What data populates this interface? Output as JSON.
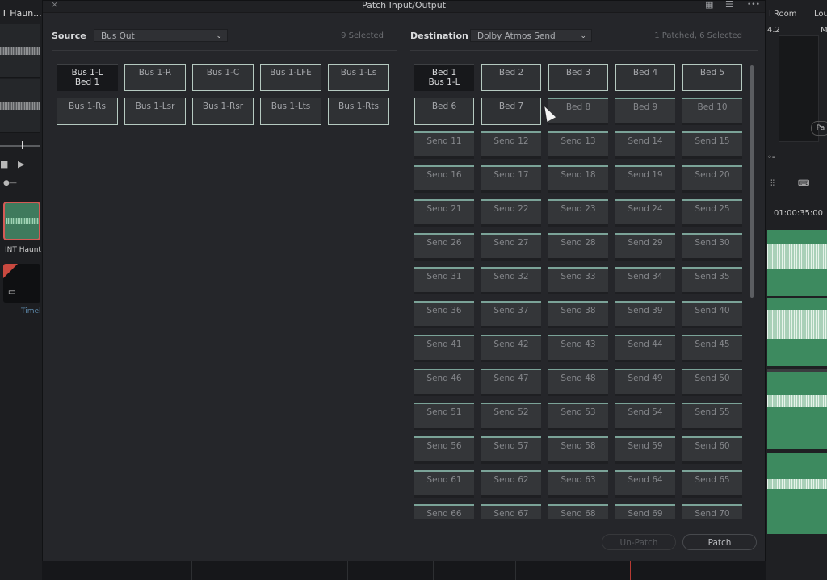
{
  "dialog": {
    "title": "Patch Input/Output",
    "close_label": "×",
    "grid_view_label": "▦",
    "list_view_label": "☰",
    "more_label": "•••"
  },
  "source": {
    "label": "Source",
    "dropdown_value": "Bus Out",
    "count_text": "9 Selected",
    "buttons": [
      {
        "line1": "Bus 1-L",
        "line2": "Bed 1",
        "state": "patched"
      },
      {
        "line1": "Bus 1-R",
        "line2": "",
        "state": "selected"
      },
      {
        "line1": "Bus 1-C",
        "line2": "",
        "state": "selected"
      },
      {
        "line1": "Bus 1-LFE",
        "line2": "",
        "state": "selected"
      },
      {
        "line1": "Bus 1-Ls",
        "line2": "",
        "state": "selected"
      },
      {
        "line1": "Bus 1-Rs",
        "line2": "",
        "state": "selected"
      },
      {
        "line1": "Bus 1-Lsr",
        "line2": "",
        "state": "selected"
      },
      {
        "line1": "Bus 1-Rsr",
        "line2": "",
        "state": "selected"
      },
      {
        "line1": "Bus 1-Lts",
        "line2": "",
        "state": "selected"
      },
      {
        "line1": "Bus 1-Rts",
        "line2": "",
        "state": "selected"
      }
    ]
  },
  "destination": {
    "label": "Destination",
    "dropdown_value": "Dolby Atmos Send",
    "count_text": "1 Patched, 6 Selected",
    "buttons": [
      {
        "line1": "Bed 1",
        "line2": "Bus 1-L",
        "state": "patched"
      },
      {
        "line1": "Bed 2",
        "line2": "",
        "state": "selected"
      },
      {
        "line1": "Bed 3",
        "line2": "",
        "state": "selected"
      },
      {
        "line1": "Bed 4",
        "line2": "",
        "state": "selected"
      },
      {
        "line1": "Bed 5",
        "line2": "",
        "state": "selected"
      },
      {
        "line1": "Bed 6",
        "line2": "",
        "state": "selected"
      },
      {
        "line1": "Bed 7",
        "line2": "",
        "state": "selected"
      },
      {
        "line1": "Bed 8",
        "line2": "",
        "state": "normal"
      },
      {
        "line1": "Bed 9",
        "line2": "",
        "state": "normal"
      },
      {
        "line1": "Bed 10",
        "line2": "",
        "state": "normal"
      },
      {
        "line1": "Send 11",
        "line2": "",
        "state": "normal"
      },
      {
        "line1": "Send 12",
        "line2": "",
        "state": "normal"
      },
      {
        "line1": "Send 13",
        "line2": "",
        "state": "normal"
      },
      {
        "line1": "Send 14",
        "line2": "",
        "state": "normal"
      },
      {
        "line1": "Send 15",
        "line2": "",
        "state": "normal"
      },
      {
        "line1": "Send 16",
        "line2": "",
        "state": "normal"
      },
      {
        "line1": "Send 17",
        "line2": "",
        "state": "normal"
      },
      {
        "line1": "Send 18",
        "line2": "",
        "state": "normal"
      },
      {
        "line1": "Send 19",
        "line2": "",
        "state": "normal"
      },
      {
        "line1": "Send 20",
        "line2": "",
        "state": "normal"
      },
      {
        "line1": "Send 21",
        "line2": "",
        "state": "normal"
      },
      {
        "line1": "Send 22",
        "line2": "",
        "state": "normal"
      },
      {
        "line1": "Send 23",
        "line2": "",
        "state": "normal"
      },
      {
        "line1": "Send 24",
        "line2": "",
        "state": "normal"
      },
      {
        "line1": "Send 25",
        "line2": "",
        "state": "normal"
      },
      {
        "line1": "Send 26",
        "line2": "",
        "state": "normal"
      },
      {
        "line1": "Send 27",
        "line2": "",
        "state": "normal"
      },
      {
        "line1": "Send 28",
        "line2": "",
        "state": "normal"
      },
      {
        "line1": "Send 29",
        "line2": "",
        "state": "normal"
      },
      {
        "line1": "Send 30",
        "line2": "",
        "state": "normal"
      },
      {
        "line1": "Send 31",
        "line2": "",
        "state": "normal"
      },
      {
        "line1": "Send 32",
        "line2": "",
        "state": "normal"
      },
      {
        "line1": "Send 33",
        "line2": "",
        "state": "normal"
      },
      {
        "line1": "Send 34",
        "line2": "",
        "state": "normal"
      },
      {
        "line1": "Send 35",
        "line2": "",
        "state": "normal"
      },
      {
        "line1": "Send 36",
        "line2": "",
        "state": "normal"
      },
      {
        "line1": "Send 37",
        "line2": "",
        "state": "normal"
      },
      {
        "line1": "Send 38",
        "line2": "",
        "state": "normal"
      },
      {
        "line1": "Send 39",
        "line2": "",
        "state": "normal"
      },
      {
        "line1": "Send 40",
        "line2": "",
        "state": "normal"
      },
      {
        "line1": "Send 41",
        "line2": "",
        "state": "normal"
      },
      {
        "line1": "Send 42",
        "line2": "",
        "state": "normal"
      },
      {
        "line1": "Send 43",
        "line2": "",
        "state": "normal"
      },
      {
        "line1": "Send 44",
        "line2": "",
        "state": "normal"
      },
      {
        "line1": "Send 45",
        "line2": "",
        "state": "normal"
      },
      {
        "line1": "Send 46",
        "line2": "",
        "state": "normal"
      },
      {
        "line1": "Send 47",
        "line2": "",
        "state": "normal"
      },
      {
        "line1": "Send 48",
        "line2": "",
        "state": "normal"
      },
      {
        "line1": "Send 49",
        "line2": "",
        "state": "normal"
      },
      {
        "line1": "Send 50",
        "line2": "",
        "state": "normal"
      },
      {
        "line1": "Send 51",
        "line2": "",
        "state": "normal"
      },
      {
        "line1": "Send 52",
        "line2": "",
        "state": "normal"
      },
      {
        "line1": "Send 53",
        "line2": "",
        "state": "normal"
      },
      {
        "line1": "Send 54",
        "line2": "",
        "state": "normal"
      },
      {
        "line1": "Send 55",
        "line2": "",
        "state": "normal"
      },
      {
        "line1": "Send 56",
        "line2": "",
        "state": "normal"
      },
      {
        "line1": "Send 57",
        "line2": "",
        "state": "normal"
      },
      {
        "line1": "Send 58",
        "line2": "",
        "state": "normal"
      },
      {
        "line1": "Send 59",
        "line2": "",
        "state": "normal"
      },
      {
        "line1": "Send 60",
        "line2": "",
        "state": "normal"
      },
      {
        "line1": "Send 61",
        "line2": "",
        "state": "normal"
      },
      {
        "line1": "Send 62",
        "line2": "",
        "state": "normal"
      },
      {
        "line1": "Send 63",
        "line2": "",
        "state": "normal"
      },
      {
        "line1": "Send 64",
        "line2": "",
        "state": "normal"
      },
      {
        "line1": "Send 65",
        "line2": "",
        "state": "normal"
      },
      {
        "line1": "Send 66",
        "line2": "",
        "state": "normal"
      },
      {
        "line1": "Send 67",
        "line2": "",
        "state": "normal"
      },
      {
        "line1": "Send 68",
        "line2": "",
        "state": "normal"
      },
      {
        "line1": "Send 69",
        "line2": "",
        "state": "normal"
      },
      {
        "line1": "Send 70",
        "line2": "",
        "state": "normal"
      }
    ]
  },
  "footer": {
    "unpatch_label": "Un-Patch",
    "patch_label": "Patch"
  },
  "background": {
    "clip_title": "T Haun...n",
    "clip_thumb_label": "INT Haunt",
    "timeline_label": "Timel",
    "room_label": "l Room",
    "loud_label": "Lou",
    "meter_value": "4.2",
    "meter_label": "M",
    "pa_button": "Pa",
    "timecode": "01:00:35:00"
  },
  "colors": {
    "accent_teal": "#7ba398",
    "selected_border": "#b5c9c0",
    "waveform_green": "#3d8a5f",
    "playhead_red": "#b63a33"
  }
}
